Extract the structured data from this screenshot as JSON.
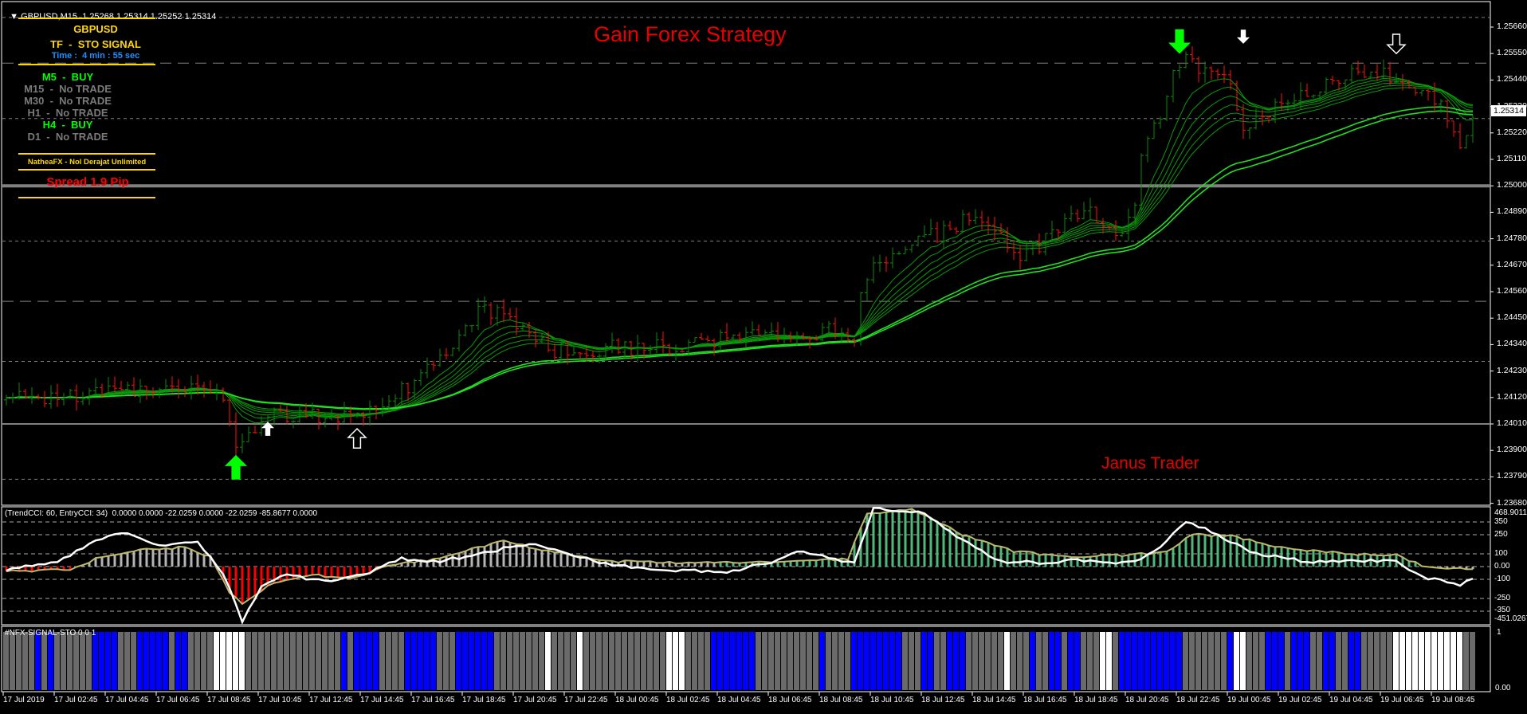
{
  "header": {
    "collapse_icon": "triangle-down-icon",
    "symbol_tf": "GBPUSD,M15",
    "ohlc": "1.25268 1.25314 1.25252 1.25314"
  },
  "title": "Gain Forex Strategy",
  "watermark_text": "Janus Trader",
  "info_panel": {
    "symbol": "GBPUSD",
    "mode": "TF  -  STO SIGNAL",
    "timer": "Time :  4 min : 55 sec",
    "signals": [
      {
        "tf": "M5",
        "label": "M5  -  BUY",
        "state": "buy"
      },
      {
        "tf": "M15",
        "label": "M15  -  No TRADE",
        "state": "none"
      },
      {
        "tf": "M30",
        "label": "M30  -  No TRADE",
        "state": "none"
      },
      {
        "tf": "H1",
        "label": "H1  -  No TRADE",
        "state": "none"
      },
      {
        "tf": "H4",
        "label": "H4  -  BUY",
        "state": "buy"
      },
      {
        "tf": "D1",
        "label": "D1  -  No TRADE",
        "state": "none"
      }
    ],
    "brand": "NatheaFX - Nol Derajat Unlimited",
    "spread": "Spread 1.9 Pip"
  },
  "colors": {
    "buy": "#00ff00",
    "none": "#7a7a7a",
    "yellow": "#ffd700",
    "timer": "#1e90ff",
    "up_bar": "#0b8a0b",
    "down_bar": "#ff1010",
    "fast_ma": "#0a9a0a",
    "slow_ma": "#22dd22",
    "cci_line": "#ffffff",
    "trend_line": "#bdb76b",
    "hist_pos": "#b4b4b4",
    "hist_pos2": "#4fb87a",
    "hist_neg": "#ff0000",
    "sto_G": "#6a6a6a",
    "sto_B": "#0000ff",
    "sto_W": "#ffffff"
  },
  "price_axis": {
    "labels": [
      "1.25660",
      "1.25550",
      "1.25440",
      "1.25330",
      "1.25220",
      "1.25110",
      "1.25000",
      "1.24890",
      "1.24780",
      "1.24670",
      "1.24560",
      "1.24450",
      "1.24340",
      "1.24230",
      "1.24120",
      "1.24010",
      "1.23900",
      "1.23790",
      "1.23680"
    ],
    "current_price": "1.25314"
  },
  "time_axis": [
    "17 Jul 2019",
    "17 Jul 02:45",
    "17 Jul 04:45",
    "17 Jul 06:45",
    "17 Jul 08:45",
    "17 Jul 10:45",
    "17 Jul 12:45",
    "17 Jul 14:45",
    "17 Jul 16:45",
    "17 Jul 18:45",
    "17 Jul 20:45",
    "17 Jul 22:45",
    "18 Jul 00:45",
    "18 Jul 02:45",
    "18 Jul 04:45",
    "18 Jul 06:45",
    "18 Jul 08:45",
    "18 Jul 10:45",
    "18 Jul 12:45",
    "18 Jul 14:45",
    "18 Jul 16:45",
    "18 Jul 18:45",
    "18 Jul 20:45",
    "18 Jul 22:45",
    "19 Jul 00:45",
    "19 Jul 02:45",
    "19 Jul 04:45",
    "19 Jul 06:45",
    "19 Jul 08:45"
  ],
  "chart_data": {
    "type": "line",
    "symbol": "GBPUSD",
    "timeframe": "M15",
    "bars": 231,
    "ylim": [
      1.2368,
      1.2572
    ],
    "levels": [
      {
        "price": 1.257,
        "style": "dash"
      },
      {
        "price": 1.2551,
        "style": "longdash"
      },
      {
        "price": 1.2528,
        "style": "dash"
      },
      {
        "price": 1.25,
        "style": "solid-thick"
      },
      {
        "price": 1.2477,
        "style": "dash"
      },
      {
        "price": 1.2452,
        "style": "longdash"
      },
      {
        "price": 1.2427,
        "style": "dash"
      },
      {
        "price": 1.2401,
        "style": "solid"
      },
      {
        "price": 1.2378,
        "style": "dash"
      }
    ],
    "price_keypoints": [
      [
        0,
        1.2411
      ],
      [
        10,
        1.2413
      ],
      [
        20,
        1.2415
      ],
      [
        30,
        1.2418
      ],
      [
        34,
        1.2412
      ],
      [
        36,
        1.2392
      ],
      [
        41,
        1.2405
      ],
      [
        48,
        1.2404
      ],
      [
        55,
        1.2405
      ],
      [
        58,
        1.241
      ],
      [
        64,
        1.2418
      ],
      [
        67,
        1.2428
      ],
      [
        72,
        1.244
      ],
      [
        75,
        1.245
      ],
      [
        78,
        1.2445
      ],
      [
        82,
        1.244
      ],
      [
        85,
        1.2432
      ],
      [
        91,
        1.2432
      ],
      [
        99,
        1.2433
      ],
      [
        107,
        1.2434
      ],
      [
        116,
        1.2437
      ],
      [
        125,
        1.2436
      ],
      [
        130,
        1.244
      ],
      [
        133,
        1.2437
      ],
      [
        134,
        1.2458
      ],
      [
        137,
        1.247
      ],
      [
        142,
        1.2476
      ],
      [
        146,
        1.248
      ],
      [
        151,
        1.2486
      ],
      [
        156,
        1.248
      ],
      [
        159,
        1.247
      ],
      [
        162,
        1.2475
      ],
      [
        165,
        1.2482
      ],
      [
        169,
        1.249
      ],
      [
        174,
        1.248
      ],
      [
        177,
        1.249
      ],
      [
        178,
        1.251
      ],
      [
        181,
        1.253
      ],
      [
        183,
        1.2545
      ],
      [
        185,
        1.2553
      ],
      [
        188,
        1.2548
      ],
      [
        192,
        1.2542
      ],
      [
        194,
        1.2525
      ],
      [
        198,
        1.2532
      ],
      [
        203,
        1.2538
      ],
      [
        207,
        1.2543
      ],
      [
        213,
        1.2547
      ],
      [
        218,
        1.2546
      ],
      [
        221,
        1.254
      ],
      [
        226,
        1.253
      ],
      [
        228,
        1.2517
      ],
      [
        231,
        1.2531
      ]
    ],
    "signals": [
      {
        "type": "buy-strong",
        "bar": 36,
        "price": 1.2383
      },
      {
        "type": "buy",
        "bar": 41,
        "price": 1.2399
      },
      {
        "type": "buy-hollow",
        "bar": 55,
        "price": 1.2395
      },
      {
        "type": "sell-strong",
        "bar": 184,
        "price": 1.256
      },
      {
        "type": "sell",
        "bar": 194,
        "price": 1.2562
      },
      {
        "type": "sell-hollow",
        "bar": 218,
        "price": 1.2559
      }
    ],
    "cci": {
      "label": "(TrendCCI: 60, EntryCCI: 34)  0.0000 0.0000 -22.0259 0.0000 -22.0259 -85.8677 0.0000",
      "ylim": [
        -451.0267,
        468.9011
      ],
      "axis_labels": [
        "468.9011",
        "350",
        "250",
        "100",
        "0.00",
        "-100",
        "-250",
        "-350",
        "-451.0267"
      ],
      "levels": [
        350,
        250,
        100,
        0,
        -100,
        -250,
        -350
      ],
      "entry_keypoints": [
        [
          0,
          -30
        ],
        [
          8,
          40
        ],
        [
          14,
          200
        ],
        [
          18,
          270
        ],
        [
          24,
          160
        ],
        [
          30,
          190
        ],
        [
          34,
          -50
        ],
        [
          37,
          -430
        ],
        [
          40,
          -150
        ],
        [
          44,
          -60
        ],
        [
          50,
          -120
        ],
        [
          56,
          -60
        ],
        [
          62,
          60
        ],
        [
          68,
          40
        ],
        [
          76,
          120
        ],
        [
          82,
          180
        ],
        [
          88,
          100
        ],
        [
          94,
          20
        ],
        [
          100,
          -20
        ],
        [
          108,
          -30
        ],
        [
          114,
          -40
        ],
        [
          120,
          40
        ],
        [
          124,
          120
        ],
        [
          130,
          60
        ],
        [
          133,
          30
        ],
        [
          136,
          460
        ],
        [
          144,
          420
        ],
        [
          150,
          200
        ],
        [
          156,
          40
        ],
        [
          162,
          30
        ],
        [
          168,
          50
        ],
        [
          174,
          30
        ],
        [
          178,
          60
        ],
        [
          182,
          200
        ],
        [
          185,
          360
        ],
        [
          190,
          250
        ],
        [
          196,
          100
        ],
        [
          204,
          40
        ],
        [
          212,
          40
        ],
        [
          218,
          50
        ],
        [
          222,
          -80
        ],
        [
          228,
          -140
        ],
        [
          231,
          -70
        ]
      ],
      "trend_keypoints": [
        [
          0,
          -40
        ],
        [
          10,
          -20
        ],
        [
          14,
          60
        ],
        [
          20,
          130
        ],
        [
          28,
          150
        ],
        [
          32,
          80
        ],
        [
          35,
          -200
        ],
        [
          37,
          -300
        ],
        [
          42,
          -120
        ],
        [
          48,
          -60
        ],
        [
          54,
          -100
        ],
        [
          60,
          10
        ],
        [
          68,
          60
        ],
        [
          74,
          150
        ],
        [
          78,
          200
        ],
        [
          86,
          110
        ],
        [
          96,
          40
        ],
        [
          110,
          30
        ],
        [
          124,
          40
        ],
        [
          132,
          60
        ],
        [
          135,
          420
        ],
        [
          142,
          450
        ],
        [
          150,
          250
        ],
        [
          158,
          120
        ],
        [
          166,
          80
        ],
        [
          176,
          90
        ],
        [
          182,
          120
        ],
        [
          186,
          250
        ],
        [
          192,
          240
        ],
        [
          200,
          150
        ],
        [
          210,
          100
        ],
        [
          218,
          90
        ],
        [
          222,
          10
        ],
        [
          231,
          -30
        ]
      ],
      "green_from_bar": 112
    },
    "sto": {
      "label": "#NFX-SIGNAL-STO 0 0 1",
      "axis_labels": [
        "1",
        "0.00"
      ],
      "runs": "G5 B1 G1 B1 G6 B4 G3 B5 G1 B2 G4 W5 G15 B1 G1 B4 G4 B5 G3 B6 G8 W1 G4 W1 G13 W3 G4 B7 G10 B1 G4 B8 G3 B2 G2 B3 G6 W1 G2 G1 B1 G2 B2 G1 B2 G3 W2 G1 B10 G7 B1 W2 G3 B3 G1 B3 G2 B2 G2 B2 G5 W11 G2"
    }
  }
}
